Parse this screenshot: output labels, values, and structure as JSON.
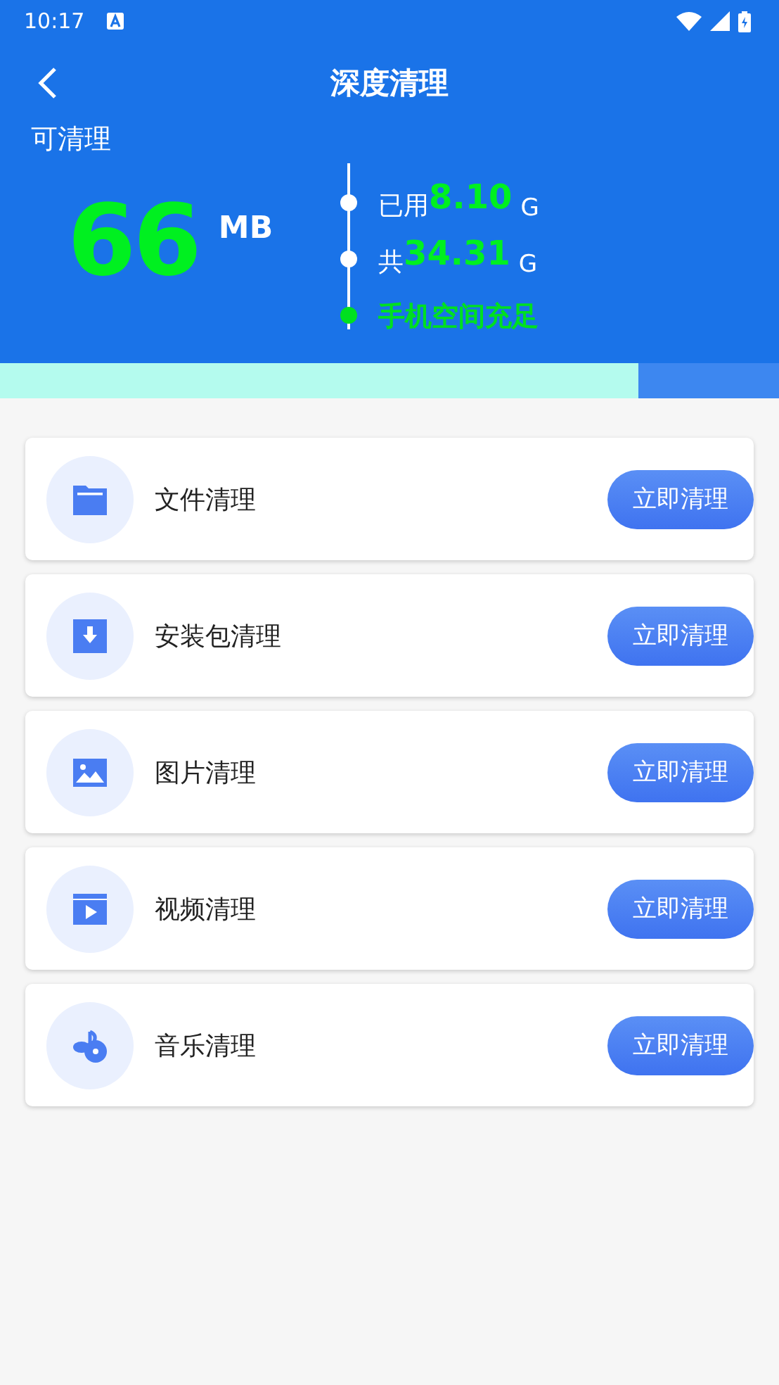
{
  "status_bar": {
    "time": "10:17"
  },
  "header": {
    "title": "深度清理"
  },
  "summary": {
    "label": "可清理",
    "amount": "66",
    "unit": "MB",
    "used": {
      "label": "已用",
      "value": "8.10",
      "unit": "G"
    },
    "total": {
      "label": "共",
      "value": "34.31",
      "unit": "G"
    },
    "status": "手机空间充足"
  },
  "storage_bar": {
    "level": 0.82
  },
  "items": [
    {
      "kind": "file",
      "name": "文件清理",
      "action": "立即清理"
    },
    {
      "kind": "package",
      "name": "安装包清理",
      "action": "立即清理"
    },
    {
      "kind": "image",
      "name": "图片清理",
      "action": "立即清理"
    },
    {
      "kind": "video",
      "name": "视频清理",
      "action": "立即清理"
    },
    {
      "kind": "music",
      "name": "音乐清理",
      "action": "立即清理"
    }
  ]
}
